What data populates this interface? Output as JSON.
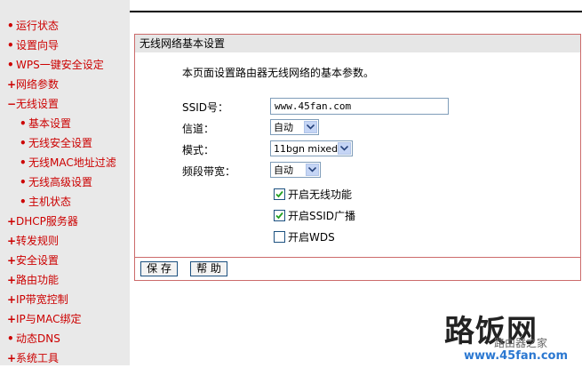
{
  "sidebar": {
    "items": [
      {
        "mark": "•",
        "label": "运行状态"
      },
      {
        "mark": "•",
        "label": "设置向导"
      },
      {
        "mark": "•",
        "label": "WPS一键安全设定"
      },
      {
        "mark": "+",
        "label": "网络参数"
      },
      {
        "mark": "−",
        "label": "无线设置"
      },
      {
        "mark": "•",
        "label": "基本设置"
      },
      {
        "mark": "•",
        "label": "无线安全设置"
      },
      {
        "mark": "•",
        "label": "无线MAC地址过滤"
      },
      {
        "mark": "•",
        "label": "无线高级设置"
      },
      {
        "mark": "•",
        "label": "主机状态"
      },
      {
        "mark": "+",
        "label": "DHCP服务器"
      },
      {
        "mark": "+",
        "label": "转发规则"
      },
      {
        "mark": "+",
        "label": "安全设置"
      },
      {
        "mark": "+",
        "label": "路由功能"
      },
      {
        "mark": "+",
        "label": "IP带宽控制"
      },
      {
        "mark": "+",
        "label": "IP与MAC绑定"
      },
      {
        "mark": "•",
        "label": "动态DNS"
      },
      {
        "mark": "+",
        "label": "系统工具"
      }
    ]
  },
  "panel": {
    "title": "无线网络基本设置",
    "description": "本页面设置路由器无线网络的基本参数。",
    "ssid_label": "SSID号：",
    "ssid_value": "www.45fan.com",
    "channel_label": "信道：",
    "channel_value": "自动",
    "mode_label": "模式：",
    "mode_value": "11bgn mixed",
    "bandwidth_label": "频段带宽：",
    "bandwidth_value": "自动",
    "checkboxes": [
      {
        "label": "开启无线功能",
        "checked": true
      },
      {
        "label": "开启SSID广播",
        "checked": true
      },
      {
        "label": "开启WDS",
        "checked": false
      }
    ],
    "save_label": "保 存",
    "help_label": "帮 助"
  },
  "watermark": {
    "brand": "路饭网",
    "sub": "路由器之家",
    "url": "www.45fan.com"
  },
  "colors": {
    "accent": "#cc0000",
    "panel_border": "#cc6b6b",
    "sidebar_bg": "#e9e9e9"
  }
}
